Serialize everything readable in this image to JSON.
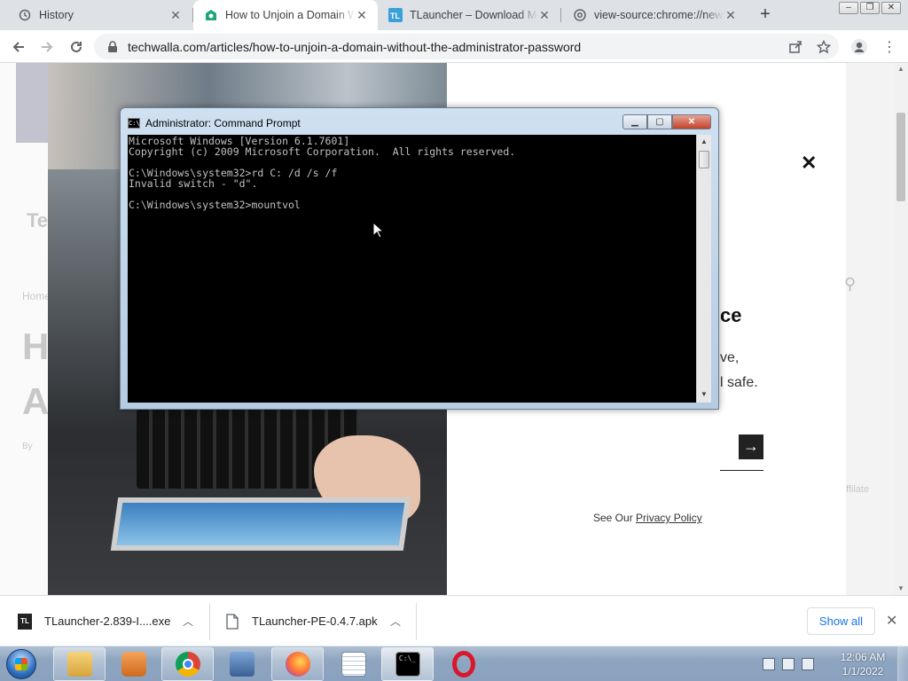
{
  "browser": {
    "tabs": [
      {
        "title": "History",
        "icon": "history-icon",
        "active": false
      },
      {
        "title": "How to Unjoin a Domain W",
        "icon": "techwalla-icon",
        "active": true
      },
      {
        "title": "TLauncher – Download Mi",
        "icon": "tlauncher-icon",
        "active": false
      },
      {
        "title": "view-source:chrome://new",
        "icon": "chrome-icon",
        "active": false
      }
    ],
    "new_tab_label": "+",
    "url": "techwalla.com/articles/how-to-unjoin-a-domain-without-the-administrator-password"
  },
  "page": {
    "modal_title_fragment": "ce",
    "modal_line1": "ve,",
    "modal_line2": "l safe.",
    "privacy_prefix": "See Our ",
    "privacy_link": "Privacy Policy",
    "bg_logo": "Te",
    "bg_breadcrumb": "Home",
    "bg_heading1": "H",
    "bg_heading2": "A",
    "bg_by": "By",
    "bg_affiliate": "ffilate"
  },
  "cmd": {
    "title": "Administrator: Command Prompt",
    "lines": [
      "Microsoft Windows [Version 6.1.7601]",
      "Copyright (c) 2009 Microsoft Corporation.  All rights reserved.",
      "",
      "C:\\Windows\\system32>rd C: /d /s /f",
      "Invalid switch - \"d\".",
      "",
      "C:\\Windows\\system32>mountvol"
    ]
  },
  "downloads": {
    "items": [
      {
        "name": "TLauncher-2.839-I....exe",
        "icon": "tlauncher-file-icon"
      },
      {
        "name": "TLauncher-PE-0.4.7.apk",
        "icon": "file-icon"
      }
    ],
    "show_all": "Show all"
  },
  "taskbar": {
    "apps": [
      "explorer-icon",
      "media-player-icon",
      "chrome-icon",
      "network-icon",
      "firefox-icon",
      "notepad-icon",
      "cmd-icon",
      "opera-icon"
    ],
    "time": "12:06 AM",
    "date": "1/1/2022"
  }
}
